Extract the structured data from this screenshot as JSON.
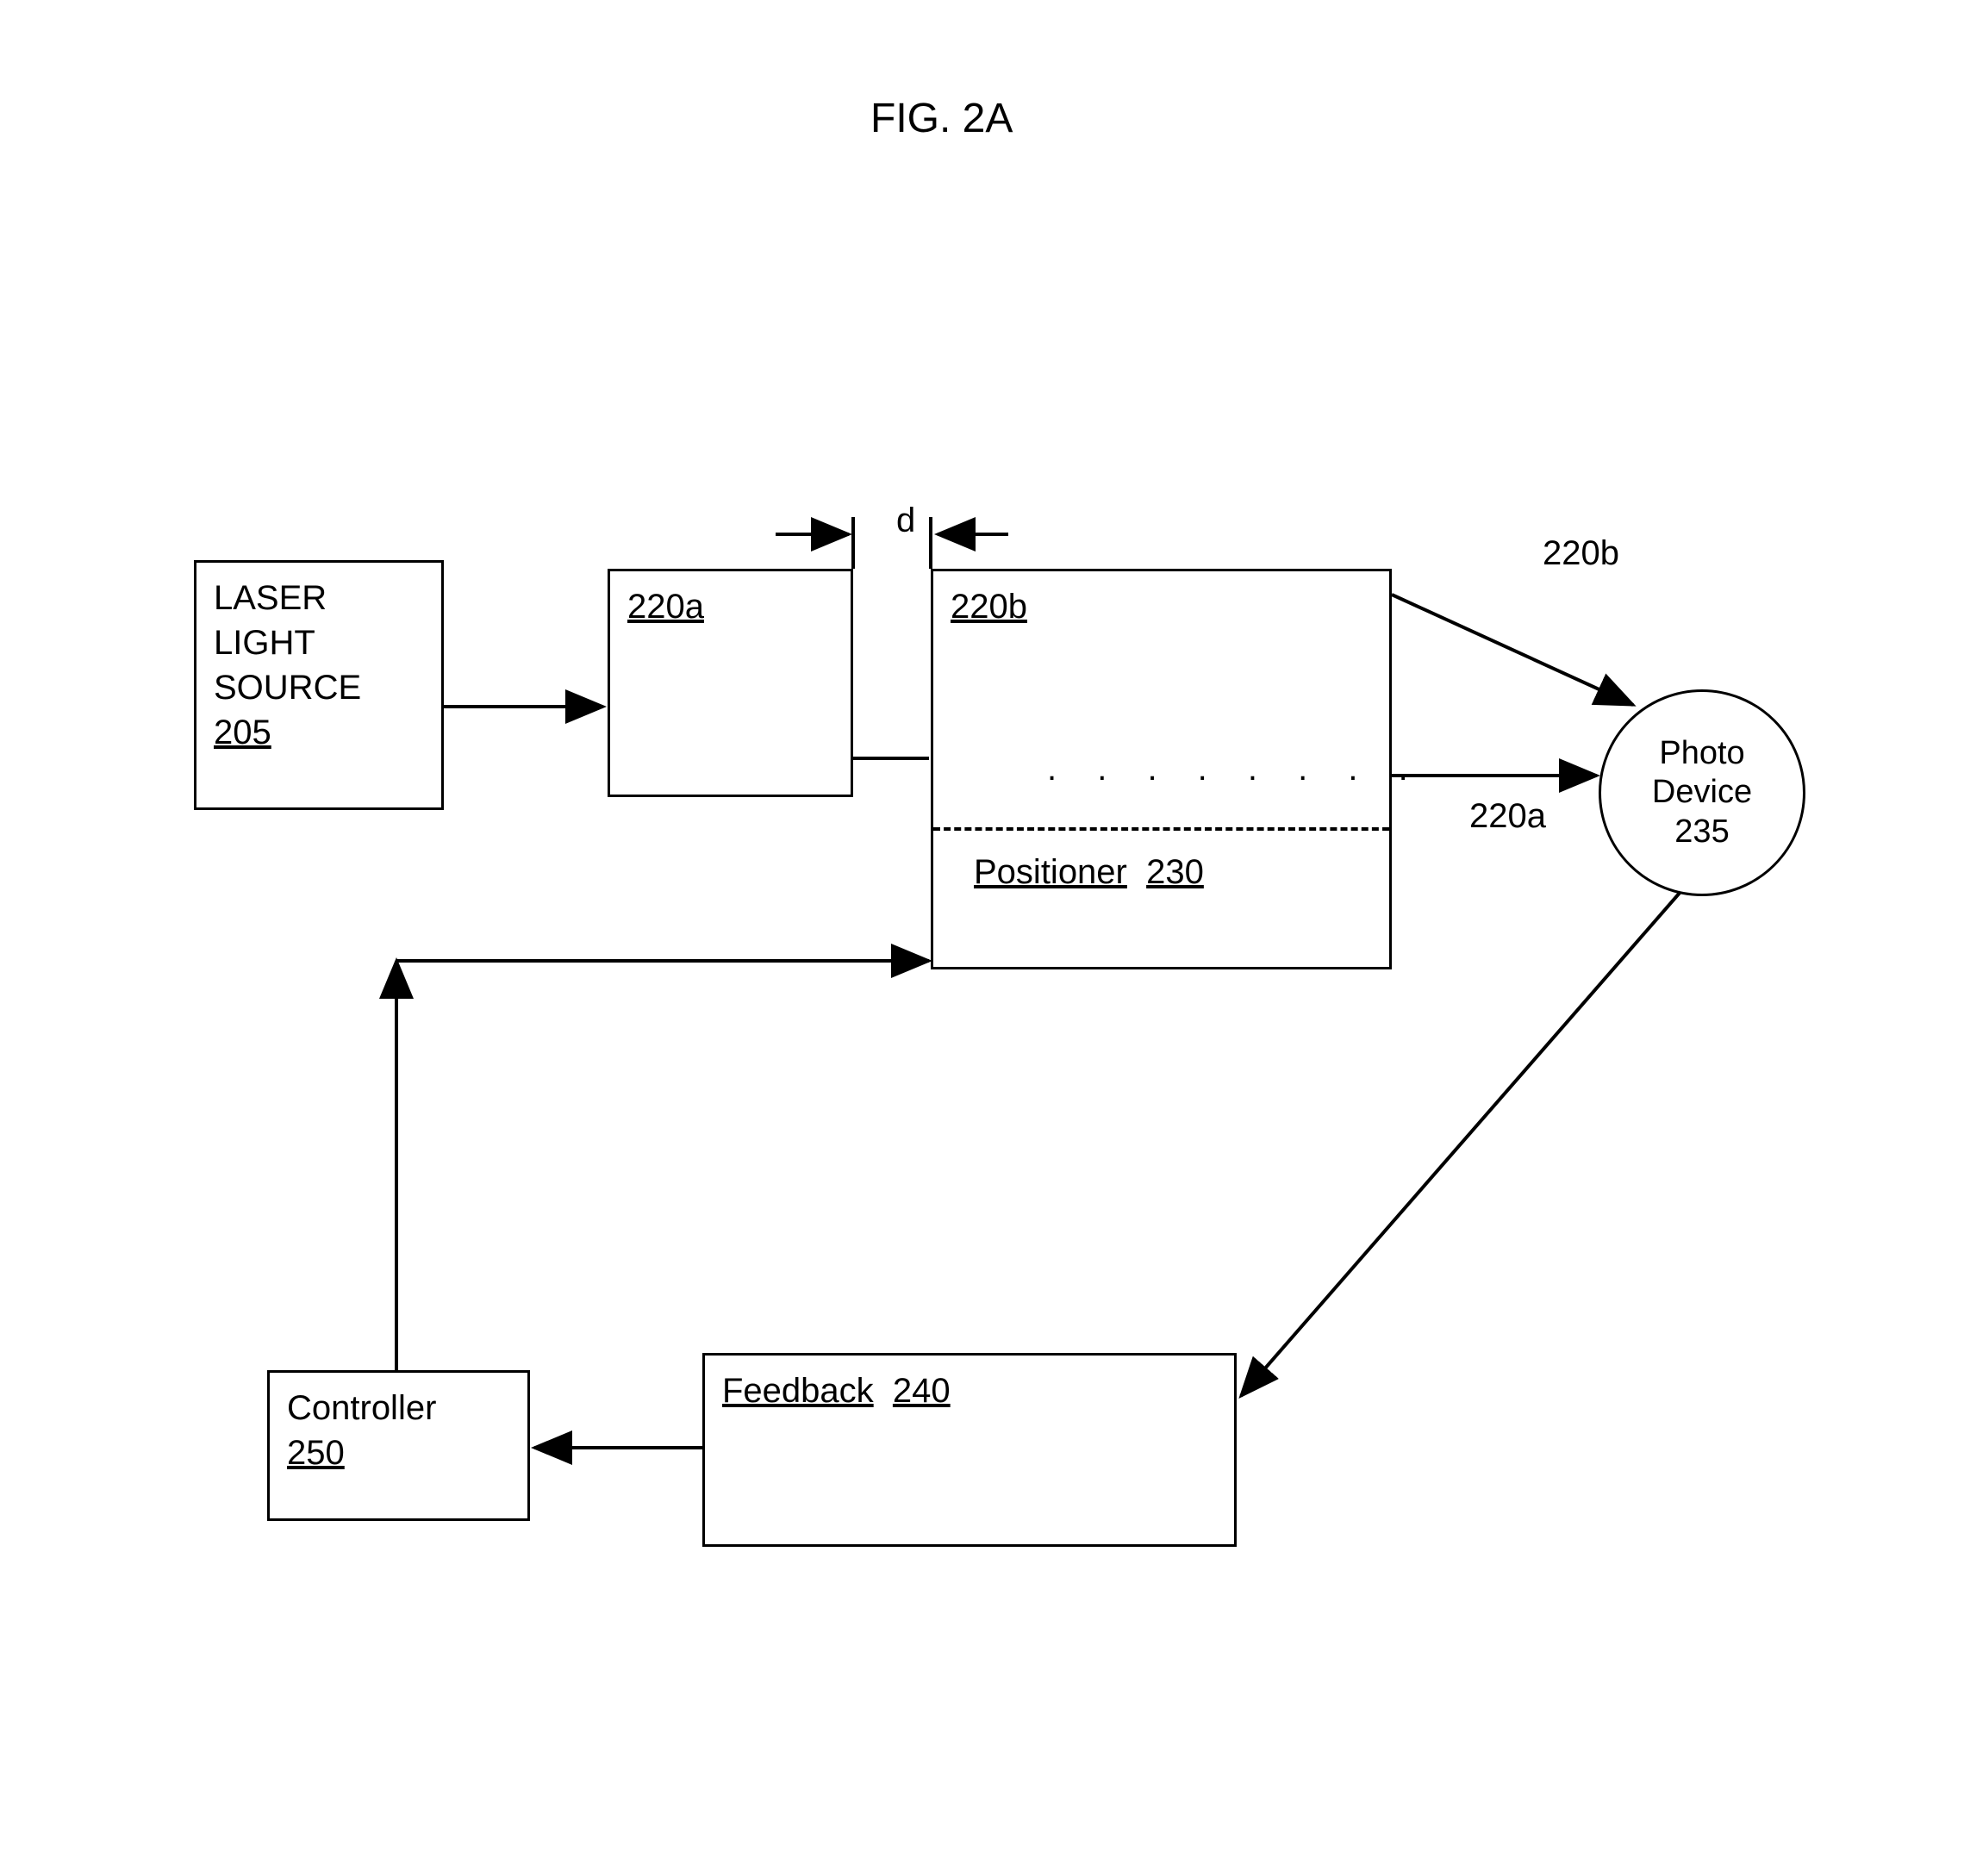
{
  "title": "FIG. 2A",
  "blocks": {
    "laser": {
      "line1": "LASER",
      "line2": "LIGHT",
      "line3": "SOURCE",
      "ref": "205"
    },
    "block220a": {
      "ref": "220a"
    },
    "block220b": {
      "ref": "220b",
      "positioner": "Positioner",
      "positioner_ref": "230"
    },
    "photo": {
      "line1": "Photo",
      "line2": "Device",
      "ref": "235"
    },
    "controller": {
      "label": "Controller",
      "ref": "250"
    },
    "feedback": {
      "label": "Feedback",
      "ref": "240"
    }
  },
  "labels": {
    "d": "d",
    "out_220a": "220a",
    "out_220b": "220b"
  }
}
